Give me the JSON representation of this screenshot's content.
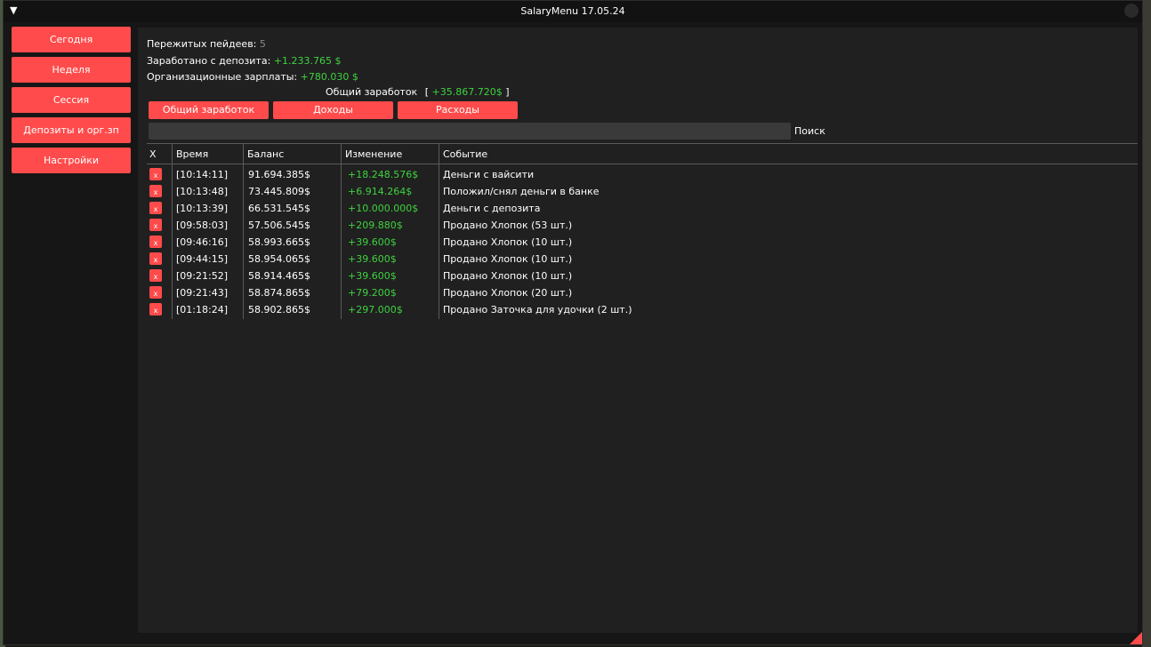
{
  "window": {
    "title": "SalaryMenu 17.05.24",
    "collapse_glyph": "▼"
  },
  "sidebar": {
    "items": [
      {
        "label": "Сегодня"
      },
      {
        "label": "Неделя"
      },
      {
        "label": "Сессия"
      },
      {
        "label": "Депозиты и орг.зп"
      },
      {
        "label": "Настройки"
      }
    ]
  },
  "stats": {
    "paydays_label": "Пережитых пейдеев:",
    "paydays_value": "5",
    "deposit_label": "Заработано с депозита:",
    "deposit_value": "+1.233.765 $",
    "org_label": "Организационные зарплаты:",
    "org_value": "+780.030 $",
    "total_label": "Общий заработок",
    "total_open": "[",
    "total_value": "+35.867.720$",
    "total_close": "]"
  },
  "tabs": [
    {
      "label": "Общий заработок"
    },
    {
      "label": "Доходы"
    },
    {
      "label": "Расходы"
    }
  ],
  "search": {
    "value": "",
    "placeholder": "",
    "label": "Поиск"
  },
  "table": {
    "headers": {
      "x": "X",
      "time": "Время",
      "balance": "Баланс",
      "change": "Изменение",
      "event": "Событие"
    },
    "delete_glyph": "x",
    "rows": [
      {
        "time": "[10:14:11]",
        "balance": "91.694.385$",
        "change": "+18.248.576$",
        "event": "Деньги с вайсити"
      },
      {
        "time": "[10:13:48]",
        "balance": "73.445.809$",
        "change": "+6.914.264$",
        "event": "Положил/снял деньги в банке"
      },
      {
        "time": "[10:13:39]",
        "balance": "66.531.545$",
        "change": "+10.000.000$",
        "event": "Деньги с депозита"
      },
      {
        "time": "[09:58:03]",
        "balance": "57.506.545$",
        "change": "+209.880$",
        "event": "Продано Хлопок (53 шт.)"
      },
      {
        "time": "[09:46:16]",
        "balance": "58.993.665$",
        "change": "+39.600$",
        "event": "Продано Хлопок (10 шт.)"
      },
      {
        "time": "[09:44:15]",
        "balance": "58.954.065$",
        "change": "+39.600$",
        "event": "Продано Хлопок (10 шт.)"
      },
      {
        "time": "[09:21:52]",
        "balance": "58.914.465$",
        "change": "+39.600$",
        "event": "Продано Хлопок (10 шт.)"
      },
      {
        "time": "[09:21:43]",
        "balance": "58.874.865$",
        "change": "+79.200$",
        "event": "Продано Хлопок (20 шт.)"
      },
      {
        "time": "[01:18:24]",
        "balance": "58.902.865$",
        "change": "+297.000$",
        "event": "Продано Заточка для удочки (2 шт.)"
      }
    ]
  },
  "colors": {
    "accent": "#ff4b4b",
    "positive": "#3fd23f",
    "window_bg": "#161616",
    "panel_bg": "#202020"
  }
}
